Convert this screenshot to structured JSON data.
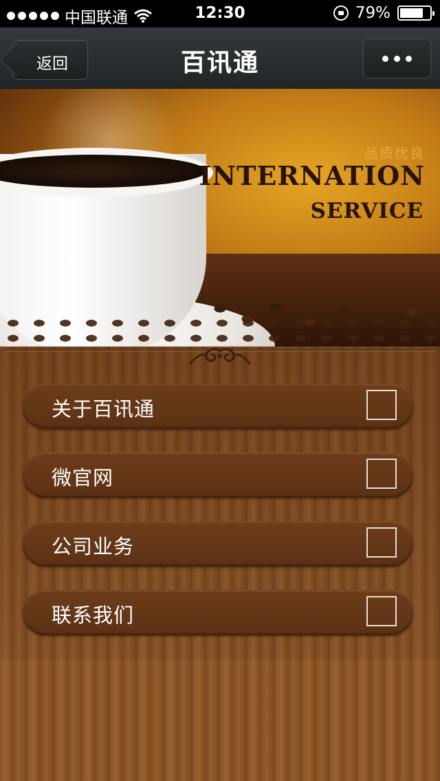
{
  "status_bar": {
    "carrier": "中国联通",
    "time": "12:30",
    "battery_percent": "79%",
    "battery_level": 0.79
  },
  "nav": {
    "back_label": "返回",
    "title": "百讯通"
  },
  "banner": {
    "tagline": "品质优良",
    "headline_line1": "INTERNATION",
    "headline_line2": "SERVICE"
  },
  "menu": {
    "items": [
      {
        "label": "关于百讯通"
      },
      {
        "label": "微官网"
      },
      {
        "label": "公司业务"
      },
      {
        "label": "联系我们"
      }
    ]
  }
}
